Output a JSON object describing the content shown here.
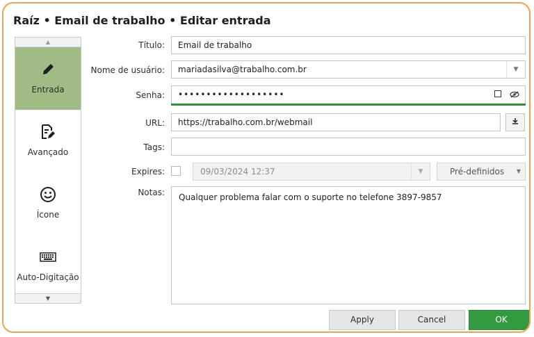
{
  "window": {
    "title": "Raíz • Email de trabalho • Editar entrada"
  },
  "sidebar": {
    "scroll_up": "▲",
    "scroll_down": "▼",
    "items": [
      {
        "label": "Entrada",
        "icon": "pencil-icon",
        "active": true
      },
      {
        "label": "Avançado",
        "icon": "document-edit-icon",
        "active": false
      },
      {
        "label": "Ícone",
        "icon": "smiley-icon",
        "active": false
      },
      {
        "label": "Auto-Digitação",
        "icon": "keyboard-icon",
        "active": false
      }
    ]
  },
  "form": {
    "title_label": "Título:",
    "title_value": "Email de trabalho",
    "username_label": "Nome de usuário:",
    "username_value": "mariadasilva@trabalho.com.br",
    "password_label": "Senha:",
    "password_value": "•••••••••••••••••••",
    "password_strength_color": "#2f8f3a",
    "url_label": "URL:",
    "url_value": "https://trabalho.com.br/webmail",
    "tags_label": "Tags:",
    "tags_value": "",
    "expires_label": "Expires:",
    "expires_value": "09/03/2024 12:37",
    "presets_label": "Pré-definidos",
    "notes_label": "Notas:",
    "notes_value": "Qualquer problema falar com o suporte no telefone 3897-9857"
  },
  "footer": {
    "apply_label": "Apply",
    "cancel_label": "Cancel",
    "ok_label": "OK"
  },
  "colors": {
    "accent_border": "#f0a24a",
    "sidebar_active": "#a0bc84",
    "ok_button": "#339a3f"
  }
}
